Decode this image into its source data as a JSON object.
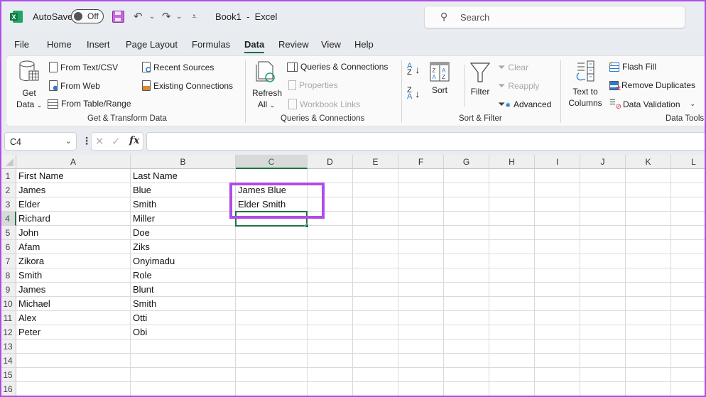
{
  "titlebar": {
    "autosave_label": "AutoSave",
    "autosave_state": "Off",
    "title": "Book1  -  Excel",
    "search_placeholder": "Search"
  },
  "menu": {
    "tabs": [
      "File",
      "Home",
      "Insert",
      "Page Layout",
      "Formulas",
      "Data",
      "Review",
      "View",
      "Help"
    ],
    "active": "Data"
  },
  "ribbon": {
    "get_transform": {
      "get_data_line1": "Get",
      "get_data_line2": "Data",
      "from_text_csv": "From Text/CSV",
      "from_web": "From Web",
      "from_table_range": "From Table/Range",
      "recent_sources": "Recent Sources",
      "existing_connections": "Existing Connections",
      "group_label": "Get & Transform Data"
    },
    "queries": {
      "refresh_line1": "Refresh",
      "refresh_line2": "All",
      "queries_connections": "Queries & Connections",
      "properties": "Properties",
      "workbook_links": "Workbook Links",
      "group_label": "Queries & Connections"
    },
    "sort_filter": {
      "sort": "Sort",
      "filter": "Filter",
      "clear": "Clear",
      "reapply": "Reapply",
      "advanced": "Advanced",
      "group_label": "Sort & Filter"
    },
    "data_tools": {
      "text_to_line1": "Text to",
      "text_to_line2": "Columns",
      "flash_fill": "Flash Fill",
      "remove_duplicates": "Remove Duplicates",
      "data_validation": "Data Validation",
      "group_label": "Data Tools"
    }
  },
  "formula_bar": {
    "name_box": "C4",
    "formula": ""
  },
  "sheet": {
    "columns": [
      "A",
      "B",
      "C",
      "D",
      "E",
      "F",
      "G",
      "H",
      "I",
      "J",
      "K",
      "L"
    ],
    "selected_column": "C",
    "selected_row": "4",
    "rows": [
      {
        "n": "1",
        "A": "First Name",
        "B": "Last Name",
        "C": ""
      },
      {
        "n": "2",
        "A": "James",
        "B": "Blue",
        "C": "James Blue"
      },
      {
        "n": "3",
        "A": "Elder",
        "B": "Smith",
        "C": "Elder Smith"
      },
      {
        "n": "4",
        "A": "Richard",
        "B": "Miller",
        "C": ""
      },
      {
        "n": "5",
        "A": "John",
        "B": "Doe",
        "C": ""
      },
      {
        "n": "6",
        "A": "Afam",
        "B": "Ziks",
        "C": ""
      },
      {
        "n": "7",
        "A": "Zikora",
        "B": "Onyimadu",
        "C": ""
      },
      {
        "n": "8",
        "A": "Smith",
        "B": "Role",
        "C": ""
      },
      {
        "n": "9",
        "A": "James",
        "B": "Blunt",
        "C": ""
      },
      {
        "n": "10",
        "A": "Michael",
        "B": "Smith",
        "C": ""
      },
      {
        "n": "11",
        "A": "Alex",
        "B": "Otti",
        "C": ""
      },
      {
        "n": "12",
        "A": "Peter",
        "B": "Obi",
        "C": ""
      },
      {
        "n": "13",
        "A": "",
        "B": "",
        "C": ""
      },
      {
        "n": "14",
        "A": "",
        "B": "",
        "C": ""
      },
      {
        "n": "15",
        "A": "",
        "B": "",
        "C": ""
      },
      {
        "n": "16",
        "A": "",
        "B": "",
        "C": ""
      }
    ]
  },
  "colors": {
    "excel_green": "#1e7145",
    "highlight_purple": "#b04ce6"
  }
}
